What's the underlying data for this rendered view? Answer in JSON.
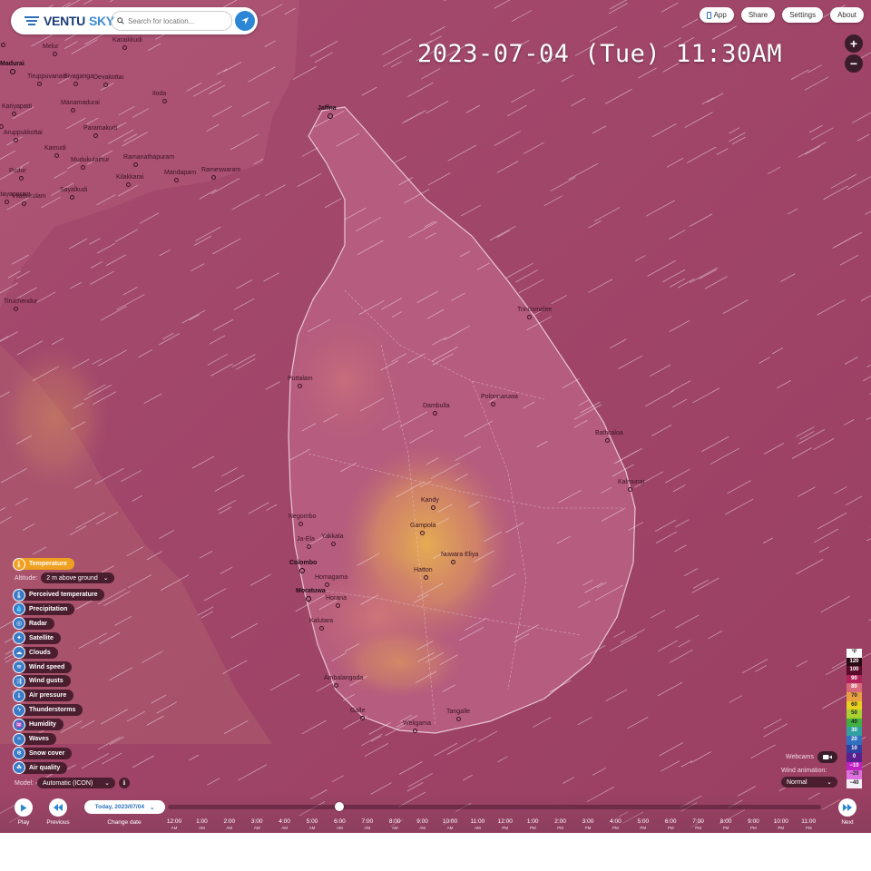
{
  "header": {
    "logo_part1": "VENTU",
    "logo_part2": "SKY",
    "search_placeholder": "Search for location...",
    "buttons": [
      "App",
      "Share",
      "Settings",
      "About"
    ]
  },
  "datetime": "2023-07-04 (Tue) 11:30AM",
  "zoom": {
    "in": "+",
    "out": "−"
  },
  "cities": [
    {
      "name": "Jaffna",
      "bold": true
    },
    {
      "name": "Trincomalee",
      "bold": false
    },
    {
      "name": "Puttalam",
      "bold": false
    },
    {
      "name": "Polonnaruwa",
      "bold": false
    },
    {
      "name": "Dambulla",
      "bold": false
    },
    {
      "name": "Batticaloa",
      "bold": false
    },
    {
      "name": "Kalmunai",
      "bold": false
    },
    {
      "name": "Kandy",
      "bold": false
    },
    {
      "name": "Gampola",
      "bold": false
    },
    {
      "name": "Negombo",
      "bold": false
    },
    {
      "name": "Ja-Ela",
      "bold": false
    },
    {
      "name": "Yakkala",
      "bold": false
    },
    {
      "name": "Nuwara Eliya",
      "bold": false
    },
    {
      "name": "Colombo",
      "bold": true
    },
    {
      "name": "Hatton",
      "bold": false
    },
    {
      "name": "Homagama",
      "bold": false
    },
    {
      "name": "Moratuwa",
      "bold": true
    },
    {
      "name": "Horana",
      "bold": false
    },
    {
      "name": "Kalutara",
      "bold": false
    },
    {
      "name": "Ambalangoda",
      "bold": false
    },
    {
      "name": "Tangalle",
      "bold": false
    },
    {
      "name": "Galle",
      "bold": false
    },
    {
      "name": "Weligama",
      "bold": false
    },
    {
      "name": "Madurai",
      "bold": true
    },
    {
      "name": "Melur",
      "bold": false
    },
    {
      "name": "Karaikkudi",
      "bold": false
    },
    {
      "name": "Tiruppuvanam",
      "bold": false
    },
    {
      "name": "Sivaganga",
      "bold": false
    },
    {
      "name": "Devakottai",
      "bold": false
    },
    {
      "name": "Kariyapatti",
      "bold": false
    },
    {
      "name": "Manamadurai",
      "bold": false
    },
    {
      "name": "Iloda",
      "bold": false
    },
    {
      "name": "Aruppukkottai",
      "bold": false
    },
    {
      "name": "Paramakudi",
      "bold": false
    },
    {
      "name": "Kamudi",
      "bold": false
    },
    {
      "name": "Mudukulathur",
      "bold": false
    },
    {
      "name": "Ramanathapuram",
      "bold": false
    },
    {
      "name": "Pudur",
      "bold": false
    },
    {
      "name": "Kilakkarai",
      "bold": false
    },
    {
      "name": "Mandapam",
      "bold": false
    },
    {
      "name": "Rameswaram",
      "bold": false
    },
    {
      "name": "Vilathikulam",
      "bold": false
    },
    {
      "name": "Sayalkudi",
      "bold": false
    },
    {
      "name": "Tiruchendur",
      "bold": false
    },
    {
      "name": "pur",
      "bold": false
    },
    {
      "name": "Ettayapuram",
      "bold": false
    },
    {
      "name": "i",
      "bold": false
    }
  ],
  "layers": {
    "active": "Temperature",
    "altitude_label": "Altitude:",
    "altitude_value": "2 m above ground",
    "items": [
      {
        "label": "Perceived temperature",
        "icon": "🌡"
      },
      {
        "label": "Precipitation",
        "icon": "💧"
      },
      {
        "label": "Radar",
        "icon": "◎"
      },
      {
        "label": "Satellite",
        "icon": "✦"
      },
      {
        "label": "Clouds",
        "icon": "☁"
      },
      {
        "label": "Wind speed",
        "icon": "≋"
      },
      {
        "label": "Wind gusts",
        "icon": "⇶"
      },
      {
        "label": "Air pressure",
        "icon": "⇓"
      },
      {
        "label": "Thunderstorms",
        "icon": "ϟ"
      },
      {
        "label": "Humidity",
        "icon": "♒"
      },
      {
        "label": "Waves",
        "icon": "≈"
      },
      {
        "label": "Snow cover",
        "icon": "❄"
      },
      {
        "label": "Air quality",
        "icon": "☘"
      }
    ],
    "model_label": "Model:",
    "model_value": "Automatic (ICON)"
  },
  "legend": {
    "unit": "°F",
    "steps": [
      {
        "label": "120",
        "color": "#2a0a14",
        "text": "#fff"
      },
      {
        "label": "100",
        "color": "#5a0a2a",
        "text": "#fff"
      },
      {
        "label": "90",
        "color": "#b0245a",
        "text": "#fff"
      },
      {
        "label": "80",
        "color": "#d86a7a",
        "text": "#fff"
      },
      {
        "label": "70",
        "color": "#e8a040",
        "text": "#222"
      },
      {
        "label": "60",
        "color": "#e8d020",
        "text": "#222"
      },
      {
        "label": "50",
        "color": "#a8d030",
        "text": "#222"
      },
      {
        "label": "40",
        "color": "#40b040",
        "text": "#222"
      },
      {
        "label": "30",
        "color": "#30a0a0",
        "text": "#fff"
      },
      {
        "label": "20",
        "color": "#3070c0",
        "text": "#fff"
      },
      {
        "label": "10",
        "color": "#3040a0",
        "text": "#fff"
      },
      {
        "label": "0",
        "color": "#5a2090",
        "text": "#fff"
      },
      {
        "label": "−10",
        "color": "#c020c0",
        "text": "#fff"
      },
      {
        "label": "−20",
        "color": "#e070e0",
        "text": "#222"
      },
      {
        "label": "−40",
        "color": "#f8f0f8",
        "text": "#222"
      }
    ]
  },
  "webcams_label": "Webcams",
  "wind_animation": {
    "label": "Wind animation:",
    "value": "Normal"
  },
  "controls": {
    "play": "Play",
    "previous": "Previous",
    "change_date": "Change date",
    "date_value": "Today, 2023/07/04",
    "next": "Next",
    "timeline_position": 0.263
  },
  "timeline": [
    {
      "t": "12:00",
      "p": "AM"
    },
    {
      "t": "1:00",
      "p": "AM"
    },
    {
      "t": "2:00",
      "p": "AM"
    },
    {
      "t": "3:00",
      "p": "AM"
    },
    {
      "t": "4:00",
      "p": "AM"
    },
    {
      "t": "5:00",
      "p": "AM"
    },
    {
      "t": "6:00",
      "p": "AM"
    },
    {
      "t": "7:00",
      "p": "AM"
    },
    {
      "t": "8:00",
      "p": "AM"
    },
    {
      "t": "9:00",
      "p": "AM"
    },
    {
      "t": "10:00",
      "p": "AM"
    },
    {
      "t": "11:00",
      "p": "AM"
    },
    {
      "t": "12:00",
      "p": "PM"
    },
    {
      "t": "1:00",
      "p": "PM"
    },
    {
      "t": "2:00",
      "p": "PM"
    },
    {
      "t": "3:00",
      "p": "PM"
    },
    {
      "t": "4:00",
      "p": "PM"
    },
    {
      "t": "5:00",
      "p": "PM"
    },
    {
      "t": "6:00",
      "p": "PM"
    },
    {
      "t": "7:00",
      "p": "PM"
    },
    {
      "t": "8:00",
      "p": "PM"
    },
    {
      "t": "9:00",
      "p": "PM"
    },
    {
      "t": "10:00",
      "p": "PM"
    },
    {
      "t": "11:00",
      "p": "PM"
    }
  ]
}
